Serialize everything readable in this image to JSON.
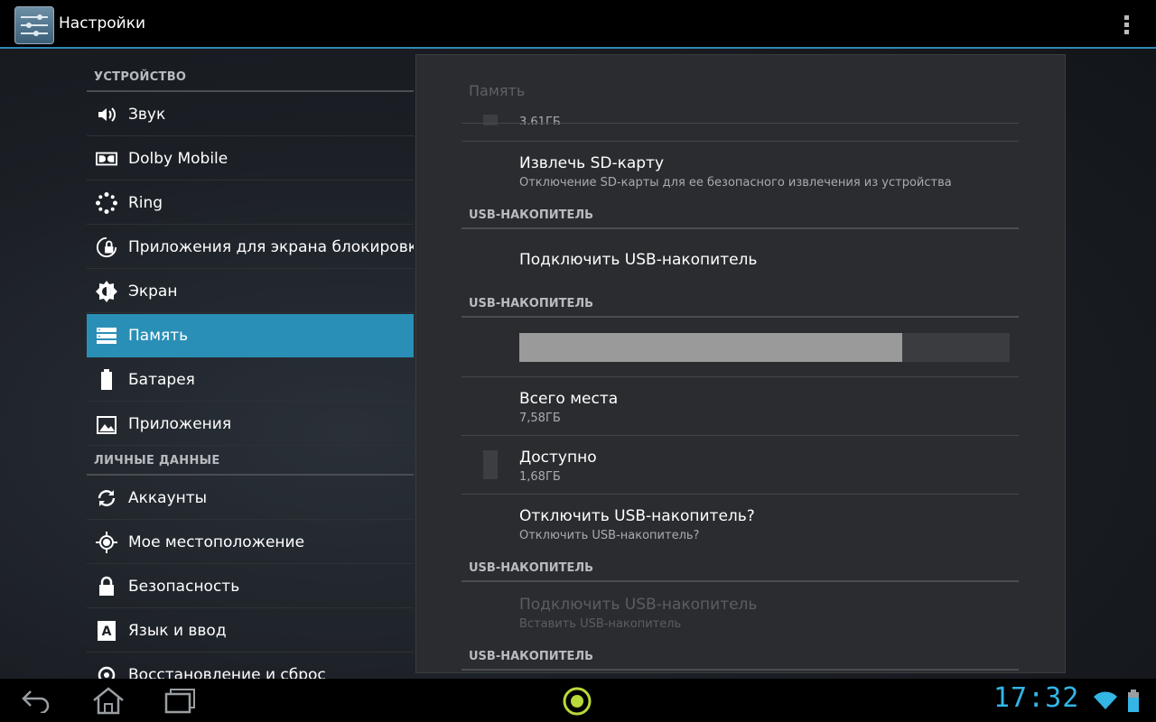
{
  "actionbar": {
    "title": "Настройки",
    "icon": "settings-icon",
    "overflow_icon": "overflow-menu-icon"
  },
  "sidebar": {
    "categories": [
      {
        "label": "УСТРОЙСТВО"
      },
      {
        "label": "ЛИЧНЫЕ ДАННЫЕ"
      }
    ],
    "items": [
      {
        "label": "Звук",
        "icon": "speaker-icon"
      },
      {
        "label": "Dolby Mobile",
        "icon": "dolby-icon"
      },
      {
        "label": "Ring",
        "icon": "ring-icon"
      },
      {
        "label": "Приложения для экрана блокировки",
        "icon": "lock-apps-icon"
      },
      {
        "label": "Экран",
        "icon": "brightness-icon"
      },
      {
        "label": "Память",
        "icon": "storage-icon",
        "selected": true
      },
      {
        "label": "Батарея",
        "icon": "battery-icon"
      },
      {
        "label": "Приложения",
        "icon": "apps-icon"
      },
      {
        "label": "Аккаунты",
        "icon": "sync-icon"
      },
      {
        "label": "Мое местоположение",
        "icon": "location-icon"
      },
      {
        "label": "Безопасность",
        "icon": "lock-icon"
      },
      {
        "label": "Язык и ввод",
        "icon": "language-icon"
      },
      {
        "label": "Восстановление и сброс",
        "icon": "backup-icon"
      }
    ]
  },
  "pane": {
    "title": "Память",
    "partial_summary": "3,61ГБ",
    "eject_sd": {
      "title": "Извлечь SD-карту",
      "summary": "Отключение SD-карты для ее безопасного извлечения из устройства"
    },
    "cat1": "USB-НАКОПИТЕЛЬ",
    "connect_usb": {
      "title": "Подключить USB-накопитель"
    },
    "cat2": "USB-НАКОПИТЕЛЬ",
    "usage_bar": {
      "used_fraction": 0.78
    },
    "total": {
      "title": "Всего места",
      "summary": "7,58ГБ"
    },
    "available": {
      "title": "Доступно",
      "summary": "1,68ГБ"
    },
    "unmount_usb": {
      "title": "Отключить USB-накопитель?",
      "summary": "Отключить USB-накопитель?"
    },
    "cat3": "USB-НАКОПИТЕЛЬ",
    "mount_usb": {
      "title": "Подключить USB-накопитель",
      "summary": "Вставить USB-накопитель"
    },
    "cat4": "USB-НАКОПИТЕЛЬ"
  },
  "navbar": {
    "time": "17:32",
    "back_icon": "back-icon",
    "home_icon": "home-icon",
    "recents_icon": "recents-icon",
    "center_icon": "dolby-launcher-icon",
    "wifi_icon": "wifi-icon",
    "battery_icon": "battery-status-icon",
    "accent": "#33b5e5"
  }
}
